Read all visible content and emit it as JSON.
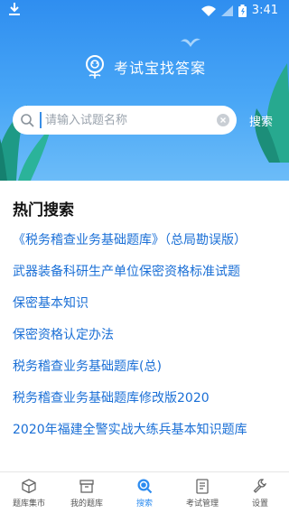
{
  "status_bar": {
    "time": "3:41"
  },
  "brand": {
    "title": "考试宝找答案"
  },
  "search": {
    "placeholder": "请输入试题名称",
    "button_label": "搜索"
  },
  "hot": {
    "title": "热门搜索",
    "items": [
      "《税务稽查业务基础题库》（总局勘误版）",
      "武器装备科研生产单位保密资格标准试题",
      "保密基本知识",
      "保密资格认定办法",
      "税务稽查业务基础题库(总)",
      "税务稽查业务基础题库修改版2020",
      "2020年福建全警实战大练兵基本知识题库"
    ]
  },
  "tabbar": {
    "tabs": [
      {
        "label": "题库集市",
        "icon": "box-icon"
      },
      {
        "label": "我的题库",
        "icon": "archive-icon"
      },
      {
        "label": "搜索",
        "icon": "search-icon"
      },
      {
        "label": "考试管理",
        "icon": "clipboard-icon"
      },
      {
        "label": "设置",
        "icon": "wrench-icon"
      }
    ],
    "active_index": 2
  },
  "colors": {
    "header": "#2f8ef0",
    "accent": "#2d8cf0",
    "link": "#1a6fd6"
  }
}
